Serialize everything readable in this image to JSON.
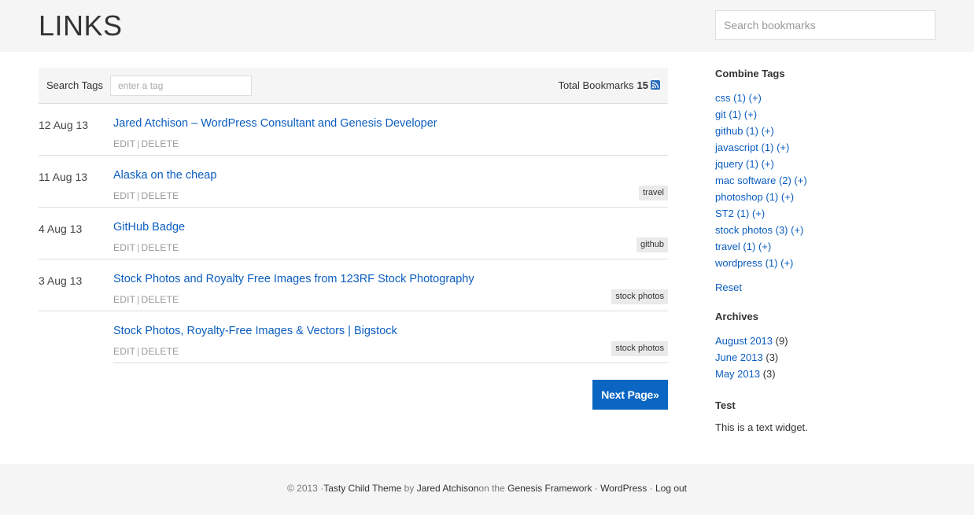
{
  "header": {
    "title": "LINKS",
    "search_placeholder": "Search bookmarks"
  },
  "tagbar": {
    "label": "Search Tags",
    "input_placeholder": "enter a tag",
    "total_label": "Total Bookmarks",
    "total_count": "15"
  },
  "bookmarks": [
    {
      "date": "12 Aug 13",
      "title": "Jared Atchison – WordPress Consultant and Genesis Developer",
      "edit": "EDIT",
      "delete": "DELETE",
      "tag": ""
    },
    {
      "date": "11 Aug 13",
      "title": "Alaska on the cheap",
      "edit": "EDIT",
      "delete": "DELETE",
      "tag": "travel"
    },
    {
      "date": "4 Aug 13",
      "title": "GitHub Badge",
      "edit": "EDIT",
      "delete": "DELETE",
      "tag": "github"
    },
    {
      "date": "3 Aug 13",
      "title": "Stock Photos and Royalty Free Images from 123RF Stock Photography",
      "edit": "EDIT",
      "delete": "DELETE",
      "tag": "stock photos"
    },
    {
      "date": "",
      "title": "Stock Photos, Royalty-Free Images & Vectors | Bigstock",
      "edit": "EDIT",
      "delete": "DELETE",
      "tag": "stock photos"
    }
  ],
  "pagination": {
    "next_label": "Next Page»"
  },
  "sidebar": {
    "combine_title": "Combine Tags",
    "tags": [
      {
        "name": "css",
        "count": "(1)",
        "plus": "(+)"
      },
      {
        "name": "git",
        "count": "(1)",
        "plus": "(+)"
      },
      {
        "name": "github",
        "count": "(1)",
        "plus": "(+)"
      },
      {
        "name": "javascript",
        "count": "(1)",
        "plus": "(+)"
      },
      {
        "name": "jquery",
        "count": "(1)",
        "plus": "(+)"
      },
      {
        "name": "mac software",
        "count": "(2)",
        "plus": "(+)"
      },
      {
        "name": "photoshop",
        "count": "(1)",
        "plus": "(+)"
      },
      {
        "name": "ST2",
        "count": "(1)",
        "plus": "(+)"
      },
      {
        "name": "stock photos",
        "count": "(3)",
        "plus": "(+)"
      },
      {
        "name": "travel",
        "count": "(1)",
        "plus": "(+)"
      },
      {
        "name": "wordpress",
        "count": "(1)",
        "plus": "(+)"
      }
    ],
    "reset_label": "Reset",
    "archives_title": "Archives",
    "archives": [
      {
        "label": "August 2013",
        "count": "(9)"
      },
      {
        "label": "June 2013",
        "count": "(3)"
      },
      {
        "label": "May 2013",
        "count": "(3)"
      }
    ],
    "test_title": "Test",
    "text_widget": "This is a text widget."
  },
  "footer": {
    "copyright": "© 2013 ·",
    "theme_link": "Tasty Child Theme",
    "by": " by ",
    "author_link": "Jared Atchison",
    "on": "on the ",
    "framework_link": "Genesis Framework",
    "sep1": " · ",
    "wordpress_link": "WordPress",
    "sep2": " · ",
    "logout_link": "Log out"
  },
  "colors": {
    "link": "#0b5dbf",
    "button": "#0a66c2",
    "header_bg": "#f5f5f5",
    "tag_bg": "#eaeaea"
  },
  "icons": {
    "rss": "rss-icon"
  }
}
